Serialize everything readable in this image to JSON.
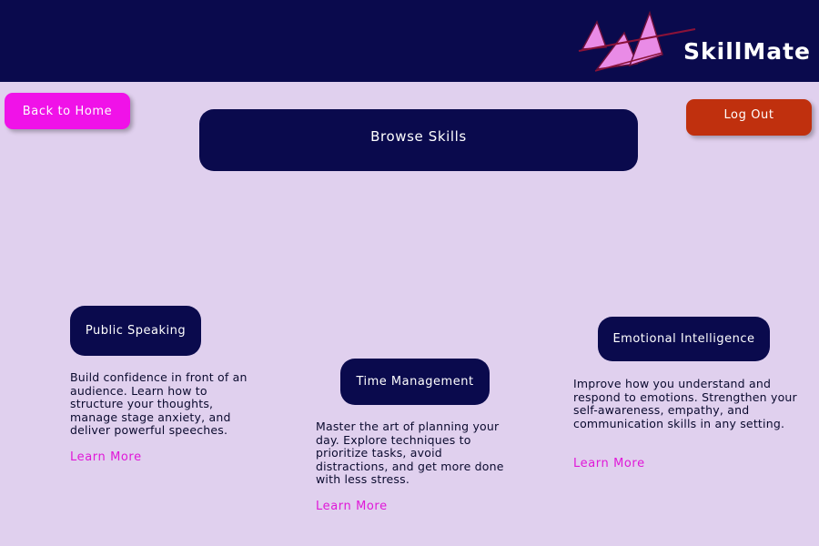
{
  "header": {
    "brand": "SkillMate",
    "logo_icon": "mountain-peaks-logo-icon",
    "background": "#0a0a4d"
  },
  "nav": {
    "back_home": "Back to Home",
    "log_out": "Log Out",
    "back_home_color": "#f012e8",
    "log_out_color": "#c0300e"
  },
  "main": {
    "browse_label": "Browse Skills"
  },
  "skills": [
    {
      "title": "Public Speaking",
      "description": "Build confidence in front of an audience. Learn how to structure your thoughts, manage stage anxiety, and deliver powerful speeches.",
      "link": "Learn More"
    },
    {
      "title": "Time Management",
      "description": "Master the art of planning your day. Explore techniques to prioritize tasks, avoid distractions, and get more done with less stress.",
      "link": "Learn More"
    },
    {
      "title": "Emotional Intelligence",
      "description": "Improve how you understand and respond to emotions. Strengthen your self-awareness, empathy, and communication skills in any setting.",
      "link": "Learn More"
    }
  ],
  "colors": {
    "page_background": "#e0d0ee",
    "accent": "#e018d8"
  }
}
